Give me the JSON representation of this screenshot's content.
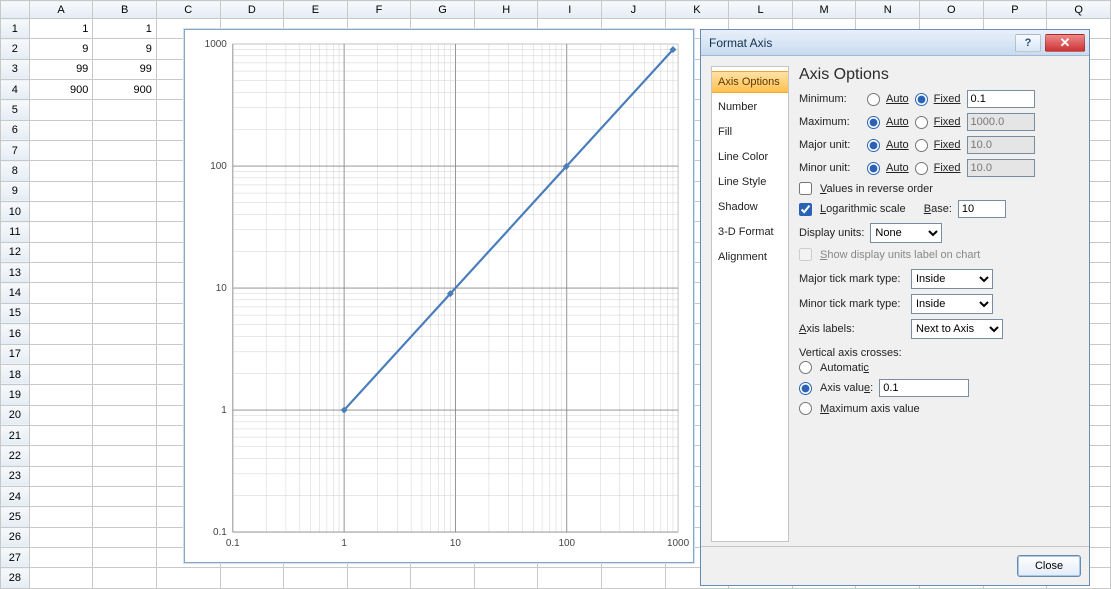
{
  "columns": [
    "A",
    "B",
    "C",
    "D",
    "E",
    "F",
    "G",
    "H",
    "I",
    "J",
    "K",
    "L",
    "M",
    "N",
    "O",
    "P",
    "Q"
  ],
  "rows": 28,
  "cells": {
    "A1": "1",
    "B1": "1",
    "A2": "9",
    "B2": "9",
    "A3": "99",
    "B3": "99",
    "A4": "900",
    "B4": "900"
  },
  "chart_data": {
    "type": "scatter",
    "x": [
      1,
      9,
      99,
      900
    ],
    "y": [
      1,
      9,
      99,
      900
    ],
    "xscale": "log",
    "yscale": "log",
    "xlim": [
      0.1,
      1000
    ],
    "ylim": [
      0.1,
      1000
    ],
    "xticks": [
      0.1,
      1,
      10,
      100,
      1000
    ],
    "yticks": [
      0.1,
      1,
      10,
      100,
      1000
    ],
    "xtick_labels": [
      "0.1",
      "1",
      "10",
      "100",
      "1000"
    ],
    "ytick_labels": [
      "0.1",
      "1",
      "10",
      "100",
      "1000"
    ]
  },
  "dialog": {
    "title": "Format Axis",
    "nav": [
      "Axis Options",
      "Number",
      "Fill",
      "Line Color",
      "Line Style",
      "Shadow",
      "3-D Format",
      "Alignment"
    ],
    "heading": "Axis Options",
    "minimum_lbl": "Minimum:",
    "maximum_lbl": "Maximum:",
    "major_lbl": "Major unit:",
    "minor_lbl": "Minor unit:",
    "auto_lbl": "Auto",
    "fixed_lbl": "Fixed",
    "min_val": "0.1",
    "max_val": "1000.0",
    "major_val": "10.0",
    "minor_val": "10.0",
    "reverse_lbl": "Values in reverse order",
    "log_lbl": "Logarithmic scale",
    "base_lbl": "Base:",
    "base_val": "10",
    "display_units_lbl": "Display units:",
    "display_units_val": "None",
    "show_units_lbl": "Show display units label on chart",
    "major_tick_lbl": "Major tick mark type:",
    "minor_tick_lbl": "Minor tick mark type:",
    "tick_val": "Inside",
    "axis_labels_lbl": "Axis labels:",
    "axis_labels_val": "Next to Axis",
    "vac_heading": "Vertical axis crosses:",
    "vac_auto": "Automatic",
    "vac_axis": "Axis value:",
    "vac_val": "0.1",
    "vac_max": "Maximum axis value",
    "close_btn": "Close"
  }
}
